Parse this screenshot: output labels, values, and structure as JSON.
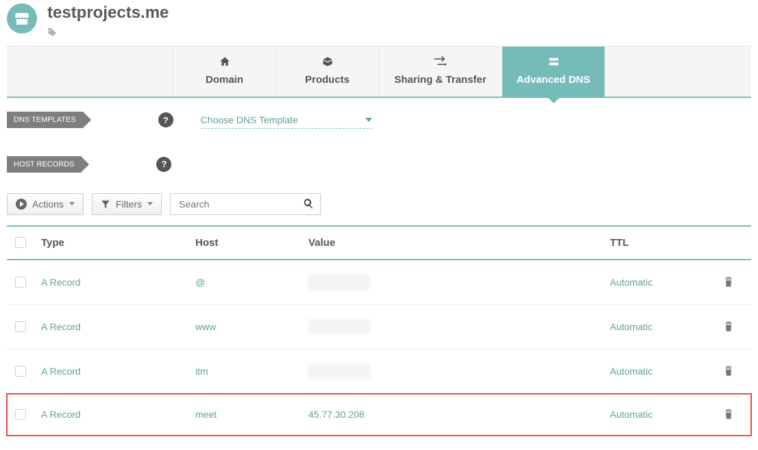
{
  "header": {
    "domain_name": "testprojects.me"
  },
  "tabs": {
    "domain": "Domain",
    "products": "Products",
    "sharing": "Sharing & Transfer",
    "advanced": "Advanced DNS"
  },
  "sections": {
    "dns_templates": "DNS TEMPLATES",
    "host_records": "HOST RECORDS",
    "choose_template": "Choose DNS Template"
  },
  "controls": {
    "actions": "Actions",
    "filters": "Filters",
    "search_placeholder": "Search"
  },
  "columns": {
    "type": "Type",
    "host": "Host",
    "value": "Value",
    "ttl": "TTL"
  },
  "records": [
    {
      "type": "A Record",
      "host": "@",
      "value": "",
      "ttl": "Automatic",
      "blurred": true
    },
    {
      "type": "A Record",
      "host": "www",
      "value": "",
      "ttl": "Automatic",
      "blurred": true
    },
    {
      "type": "A Record",
      "host": "itm",
      "value": "",
      "ttl": "Automatic",
      "blurred": true
    },
    {
      "type": "A Record",
      "host": "meet",
      "value": "45.77.30.208",
      "ttl": "Automatic",
      "blurred": false,
      "highlighted": true
    }
  ]
}
